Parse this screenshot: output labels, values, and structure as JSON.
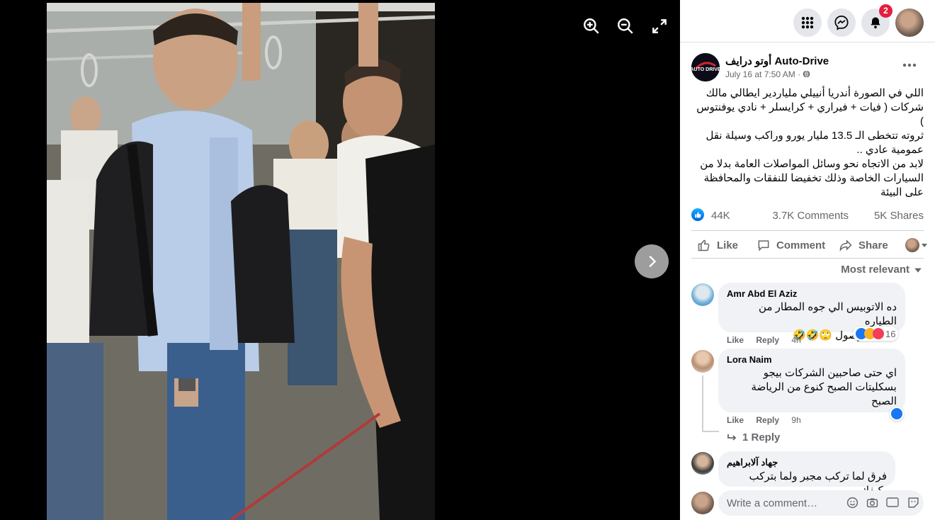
{
  "viewer": {
    "icons": [
      "zoom-in-icon",
      "zoom-out-icon",
      "fullscreen-icon",
      "next-arrow-icon"
    ]
  },
  "topbar": {
    "notification_count": "2",
    "icons": [
      "menu-grid-icon",
      "messenger-icon",
      "notifications-bell-icon"
    ]
  },
  "post": {
    "page_name": "أوتو درايف Auto-Drive",
    "date": "July 16 at 7:50 AM",
    "audience_sep": "·",
    "text_lines": [
      "اللي في الصورة أندريا أنييلي ملياردير ايطالي مالك",
      "شركات ( فيات + فيراري + كرايسلر + نادي يوفنتوس )",
      "ثروته تتخطى الـ 13.5 مليار يورو وراكب وسيلة نقل",
      "عمومية عادي ..",
      "لابد من الاتجاه نحو وسائل المواصلات العامة بدلا من",
      "السيارات الخاصة وذلك تخفيضا للنفقات والمحافظة",
      "على البيئة"
    ],
    "reactions_count": "44K",
    "comments_count": "3.7K Comments",
    "shares_count": "5K Shares"
  },
  "actions": {
    "like": "Like",
    "comment": "Comment",
    "share": "Share"
  },
  "sort_label": "Most relevant",
  "comments": [
    {
      "name": "Amr Abd El Aziz",
      "text_lines": [
        "ده الاتوبيس الي جوه المطار من الطياره",
        "لصاله الوصول 🙄🤣🤣"
      ],
      "like": "Like",
      "reply": "Reply",
      "time": "4h",
      "reaction_count": "16"
    },
    {
      "name": "Lora Naim",
      "text_lines": [
        "اي حتى صاحبين الشركات بيجو",
        "بسكليتات الصبح كنوع من الرياضة",
        "الصبح"
      ],
      "like": "Like",
      "reply": "Reply",
      "time": "9h",
      "replies_link": "1 Reply"
    },
    {
      "name": "جهاد آلابراهيم",
      "text_lines": [
        "فرق لما تركب مجبر ولما بتركب بكيفك"
      ]
    }
  ],
  "composer": {
    "placeholder": "Write a comment…",
    "gif_label": "GIF"
  },
  "colors": {
    "like_blue": "#1877f2",
    "badge_red": "#e41e3f",
    "panel_bg": "#ffffff",
    "bubble_bg": "#f0f2f5"
  }
}
